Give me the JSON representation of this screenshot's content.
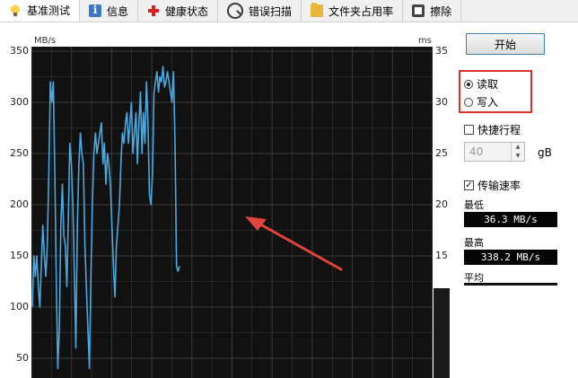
{
  "tabs": [
    {
      "label": "基准测试",
      "icon": "lightbulb-icon",
      "active": true
    },
    {
      "label": "信息",
      "icon": "info-icon",
      "active": false
    },
    {
      "label": "健康状态",
      "icon": "health-cross-icon",
      "active": false
    },
    {
      "label": "错误扫描",
      "icon": "magnifier-icon",
      "active": false
    },
    {
      "label": "文件夹占用率",
      "icon": "folder-icon",
      "active": false
    },
    {
      "label": "擦除",
      "icon": "trash-icon",
      "active": false
    }
  ],
  "chart": {
    "left_unit": "MB/s",
    "right_unit": "ms",
    "left_ticks": [
      "350",
      "300",
      "250",
      "200",
      "150",
      "100",
      "50"
    ],
    "right_ticks": [
      "35",
      "30",
      "25",
      "20",
      "15"
    ],
    "colors": {
      "background": "#111111",
      "grid": "#3a3a3a",
      "line": "#4aa8e0",
      "annotation_arrow": "#e0443a"
    }
  },
  "chart_data": {
    "type": "line",
    "xlabel": "",
    "ylabel": "MB/s",
    "ylim": [
      40,
      355
    ],
    "grid": true,
    "series": [
      {
        "values": [
          100,
          150,
          130,
          150,
          120,
          100,
          140,
          180,
          150,
          130,
          160,
          230,
          320,
          300,
          320,
          230,
          120,
          40,
          80,
          180,
          220,
          170,
          160,
          120,
          190,
          260,
          240,
          200,
          130,
          60,
          180,
          240,
          270,
          250,
          240,
          160,
          120,
          80,
          40,
          130,
          200,
          250,
          270,
          250,
          260,
          270,
          280,
          240,
          260,
          220,
          250,
          240,
          220,
          180,
          140,
          110,
          160,
          180,
          200,
          240,
          270,
          260,
          280,
          290,
          260,
          280,
          300,
          250,
          270,
          290,
          240,
          280,
          310,
          250,
          290,
          260,
          320,
          280,
          210,
          200,
          230,
          310,
          320,
          330,
          310,
          325,
          320,
          335,
          315,
          320,
          330,
          320,
          310,
          300,
          330,
          260,
          140,
          135,
          140
        ]
      }
    ]
  },
  "panel": {
    "start_label": "开始",
    "read_label": "读取",
    "write_label": "写入",
    "read_selected": true,
    "quick_label": "快捷行程",
    "quick_checked": false,
    "spin_value": "40",
    "spin_unit": "gB",
    "transfer_label": "传输速率",
    "transfer_checked": true,
    "min_label": "最低",
    "min_value": "36.3 MB/s",
    "max_label": "最高",
    "max_value": "338.2 MB/s",
    "avg_label": "平均"
  }
}
